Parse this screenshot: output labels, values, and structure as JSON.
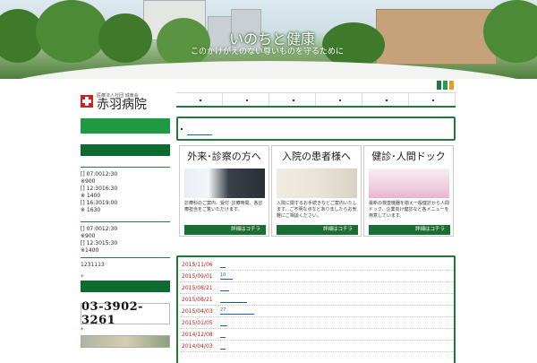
{
  "hero": {
    "title": "いのちと健康",
    "subtitle": "このかけがえのない尊いものを守るために"
  },
  "hospital": {
    "corp_name": "医療法人社団 城東会",
    "name": "赤羽病院"
  },
  "hours_1": [
    "[] 07:0012:30",
    "※900",
    "[] 12:3016:30",
    "※ 1400",
    "[] 16:3019:00",
    "※ 1630"
  ],
  "hours_2": [
    "[] 07:0012:30",
    "※900",
    "[] 12:3015:30",
    "※1400"
  ],
  "postal": "1231113",
  "telephone": "03-3902-3261",
  "colors": {
    "accent": "#1e7a3a",
    "button": "#1b6e32",
    "date": "#c02020",
    "link": "#1b5fa8"
  },
  "cards": [
    {
      "title": "外来･診察の方へ",
      "text": "診療科のご案内、受付･診療時間、各診療担当をご覧いただけます。",
      "button": "詳細はコチラ"
    },
    {
      "title": "入院の患者様へ",
      "text": "入院に関するお手続きなどご案内いたします。ご不明な点などありましたらお気軽にご相談ください。",
      "button": "詳細はコチラ"
    },
    {
      "title": "健診･人間ドック",
      "text": "最新の検査機器を揃え一般健診から人間ドック、企業向け健診など各メニューを用意しています。",
      "button": "詳細はコチラ"
    }
  ],
  "news": [
    {
      "date": "2015/11/06",
      "text": ""
    },
    {
      "date": "2015/09/01",
      "text": "10"
    },
    {
      "date": "2015/08/21",
      "text": ""
    },
    {
      "date": "2015/08/21",
      "text": ""
    },
    {
      "date": "2015/04/03",
      "text": "27"
    },
    {
      "date": "2015/01/05",
      "text": ""
    },
    {
      "date": "2014/12/08",
      "text": ""
    },
    {
      "date": "2014/04/03",
      "text": ""
    }
  ]
}
